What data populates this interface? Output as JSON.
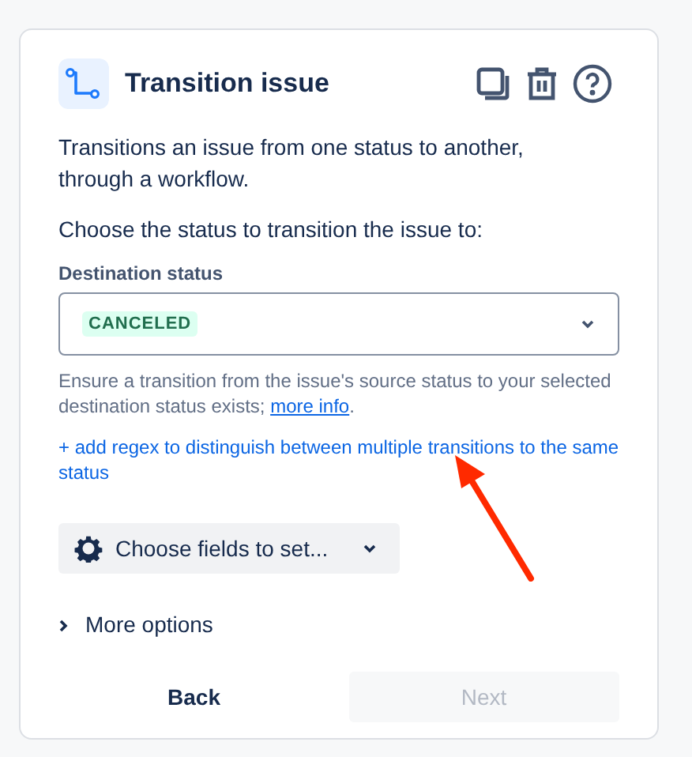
{
  "panel": {
    "title": "Transition issue",
    "description": "Transitions an issue from one status to another, through a workflow.",
    "prompt": "Choose the status to transition the issue to:",
    "destination": {
      "label": "Destination status",
      "value": "CANCELED",
      "help": "Ensure a transition from the issue's source status to your selected destination status exists;",
      "help_link": "more info",
      "help_end": "."
    },
    "regex_link": "+ add regex to distinguish between multiple transitions to the same status",
    "fields_button": "Choose fields to set...",
    "more_options": {
      "label": "More options",
      "expanded": false
    },
    "buttons": [
      {
        "label": "Back",
        "disabled": false
      },
      {
        "label": "Next",
        "disabled": true
      }
    ]
  }
}
